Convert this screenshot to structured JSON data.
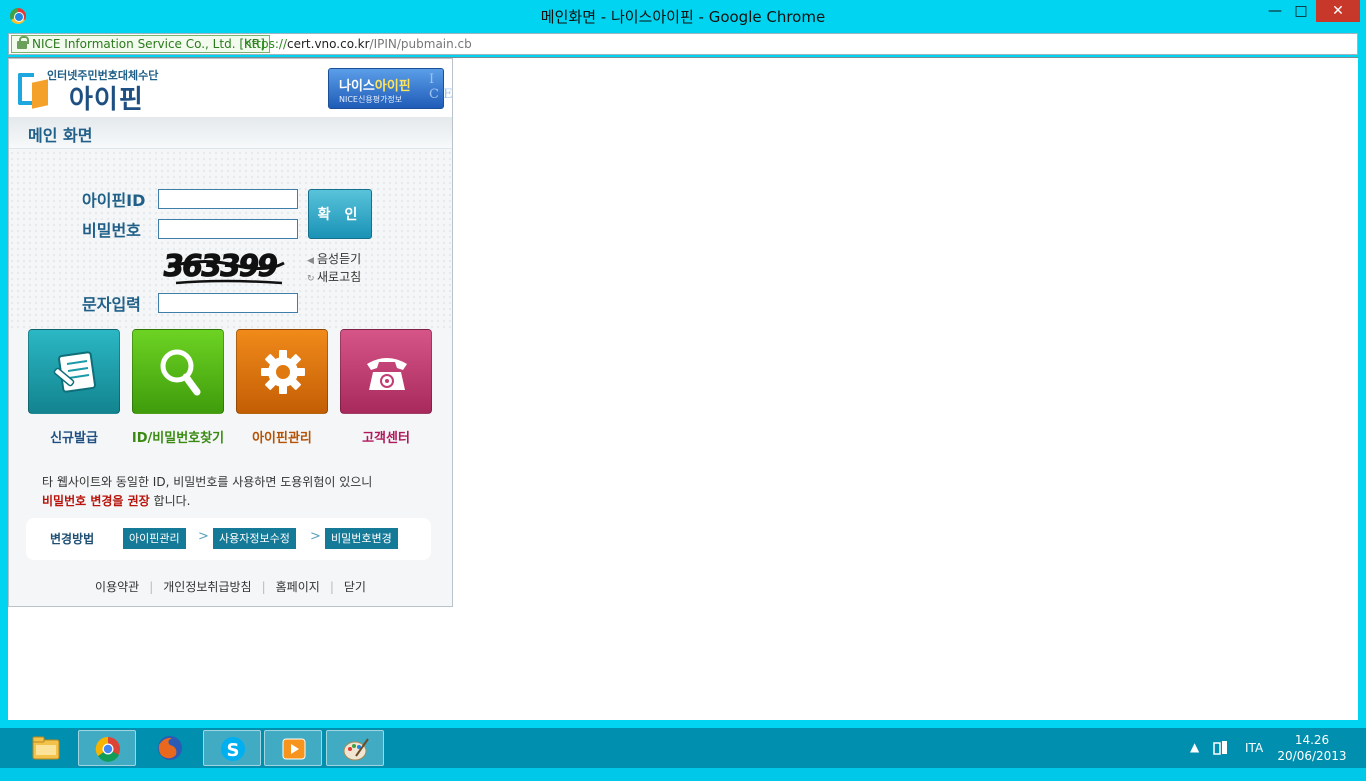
{
  "window": {
    "title": "메인화면 - 나이스아이핀 - Google Chrome",
    "minimize": "—",
    "maximize": "□",
    "close": "✕"
  },
  "address": {
    "ev_name": "NICE Information Service Co., Ltd. [KR]",
    "scheme": "https://",
    "host": "cert.vno.co.kr",
    "path": "/IPIN/pubmain.cb"
  },
  "logo": {
    "subtitle": "인터넷주민번호대체수단",
    "name": "아이핀"
  },
  "nice_badge": {
    "line1_prefix": "나이스",
    "line1_highlight": "아이핀",
    "line2": "NICE신용평가정보",
    "letters": "I\nC E"
  },
  "page": {
    "title": "메인 화면"
  },
  "login": {
    "id_label": "아이핀ID",
    "id_value": "",
    "password_label": "비밀번호",
    "password_value": "",
    "captcha_text": "363399",
    "listen_label": "음성듣기",
    "refresh_label": "새로고침",
    "captcha_label": "문자입력",
    "captcha_value": "",
    "confirm_label": "확 인"
  },
  "tiles": [
    {
      "label": "신규발급",
      "color": "#1a9aa8",
      "label_color": "#1f4f82",
      "icon": "document-pen-icon"
    },
    {
      "label": "ID/비밀번호찾기",
      "color": "#5cbd1a",
      "label_color": "#3a8a12",
      "icon": "magnifier-icon"
    },
    {
      "label": "아이핀관리",
      "color": "#e07910",
      "label_color": "#b45208",
      "icon": "gear-icon"
    },
    {
      "label": "고객센터",
      "color": "#c23e72",
      "label_color": "#b0185c",
      "icon": "telephone-icon"
    }
  ],
  "notice": {
    "line1": "타 웹사이트와 동일한 ID, 비밀번호를 사용하면 도용위험이 있으니",
    "line2_red": "비밀번호 변경을 권장",
    "line2_rest": " 합니다."
  },
  "howto": {
    "label": "변경방법",
    "steps": [
      "아이핀관리",
      "사용자정보수정",
      "비밀번호변경"
    ],
    "arrow": ">"
  },
  "footer": {
    "links": [
      "이용약관",
      "개인정보취급방침",
      "홈페이지",
      "닫기"
    ],
    "separator": "|"
  },
  "taskbar": {
    "apps": [
      "file-explorer-icon",
      "chrome-icon",
      "firefox-icon",
      "skype-icon",
      "media-player-icon",
      "paint-icon"
    ],
    "tray_arrow": "▲",
    "language": "ITA",
    "time": "14.26",
    "date": "20/06/2013"
  }
}
